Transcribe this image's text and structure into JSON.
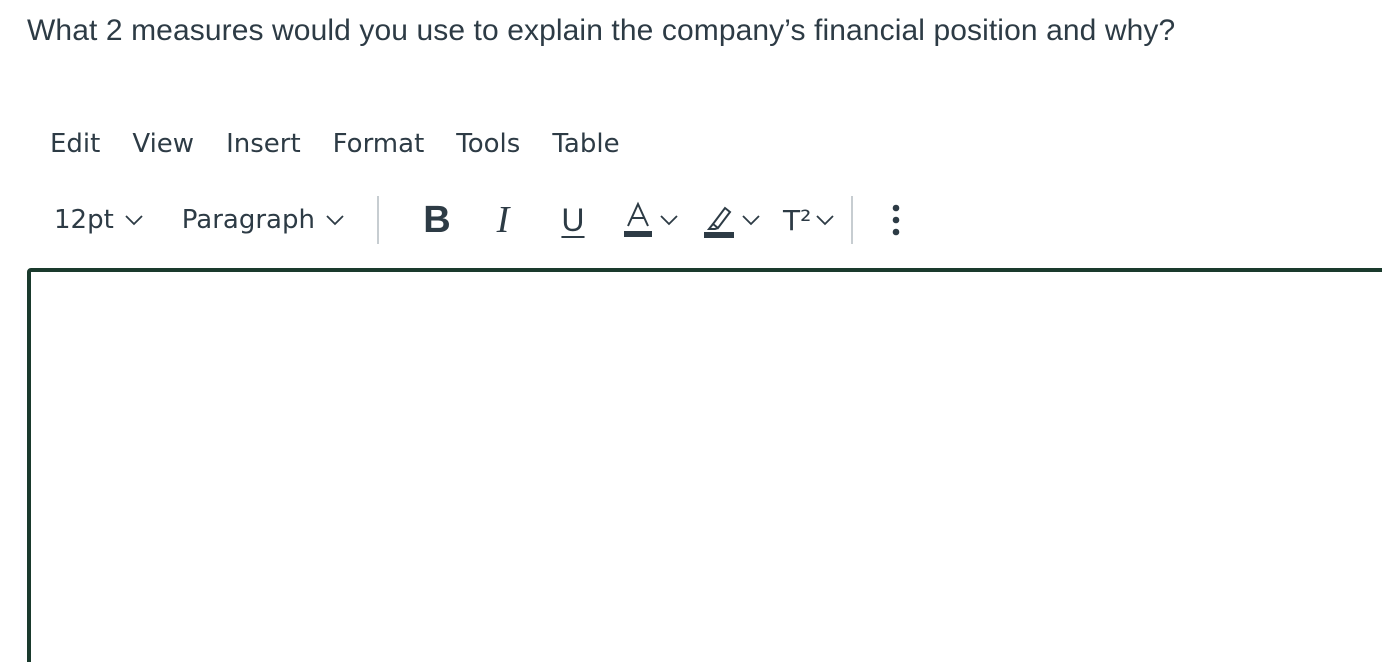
{
  "question": {
    "text": "What 2 measures would you use to explain the company’s financial position and why?"
  },
  "menubar": {
    "items": [
      "Edit",
      "View",
      "Insert",
      "Format",
      "Tools",
      "Table"
    ]
  },
  "toolbar": {
    "font_size": "12pt",
    "block_format": "Paragraph",
    "bold_label": "B",
    "italic_label": "I",
    "underline_label": "U",
    "superscript_label": "T²",
    "text_color_icon": "text-color-icon",
    "highlight_icon": "highlight-icon",
    "more_icon": "more-vertical-icon",
    "indicator_color": "#2d3b45"
  },
  "editor": {
    "content": "",
    "border_color": "#1a3a2d"
  }
}
